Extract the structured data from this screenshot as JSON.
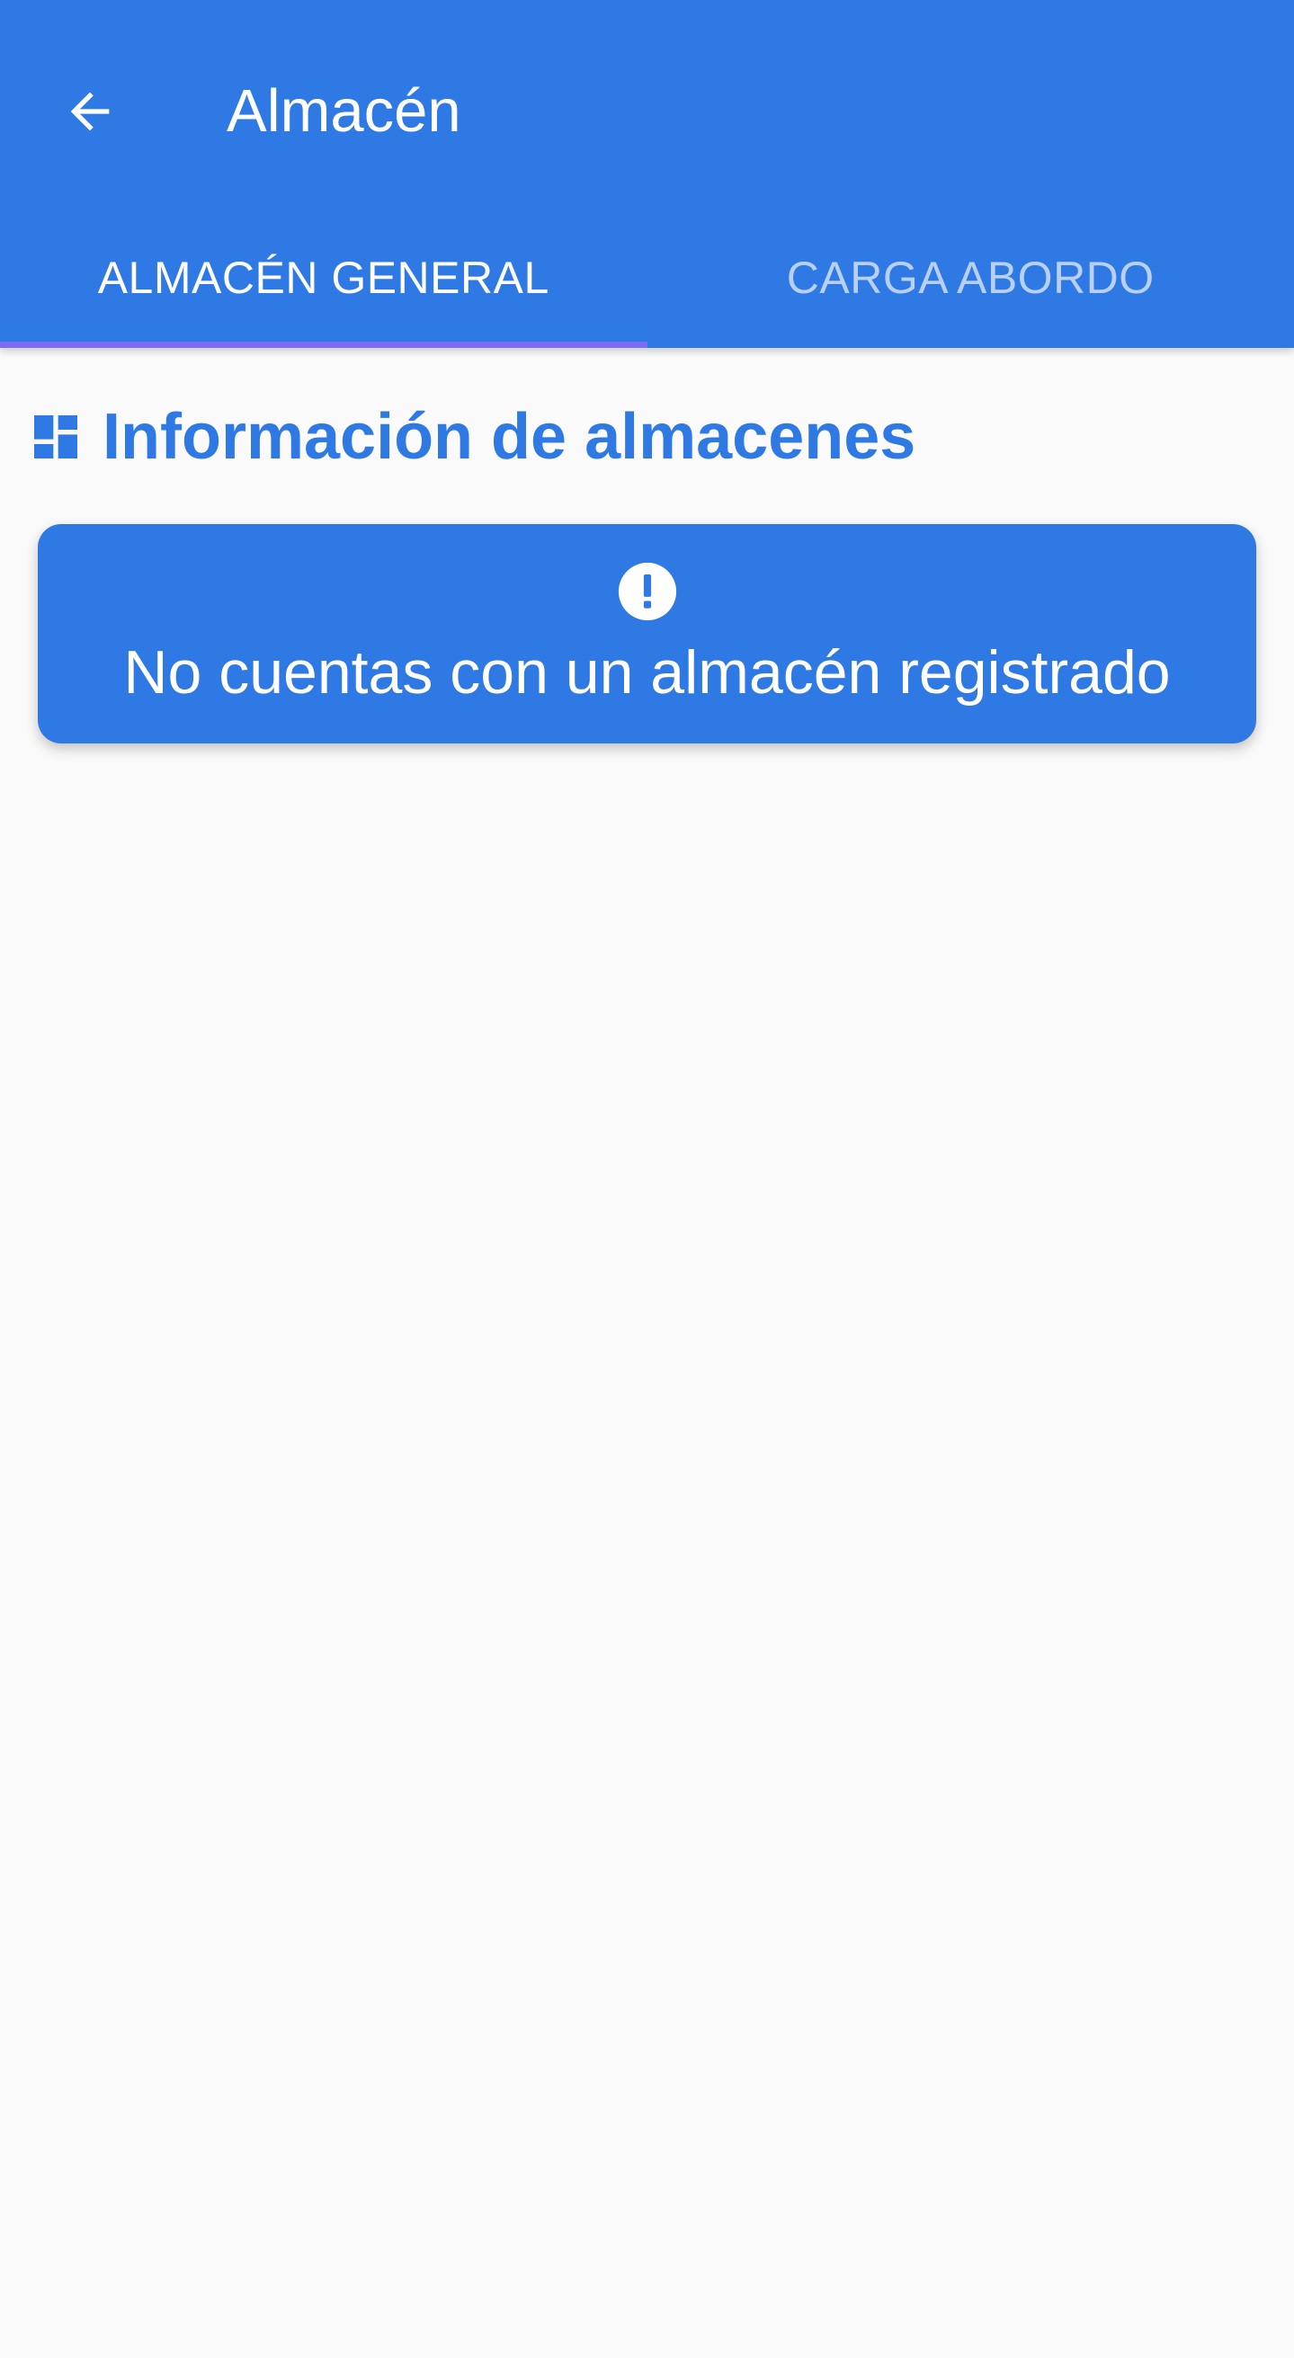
{
  "appbar": {
    "back_icon": "arrow-left-icon",
    "title": "Almacén"
  },
  "tabs": [
    {
      "label": "ALMACÉN GENERAL",
      "active": true
    },
    {
      "label": "CARGA ABORDO",
      "active": false
    }
  ],
  "section": {
    "icon": "dashboard-icon",
    "title": "Información de almacenes"
  },
  "notice": {
    "icon": "exclamation-circle-icon",
    "message": "No cuentas con un almacén registrado"
  },
  "colors": {
    "primary": "#2e79e3",
    "tab_indicator": "#7b6cf6",
    "background": "#fafafa"
  }
}
